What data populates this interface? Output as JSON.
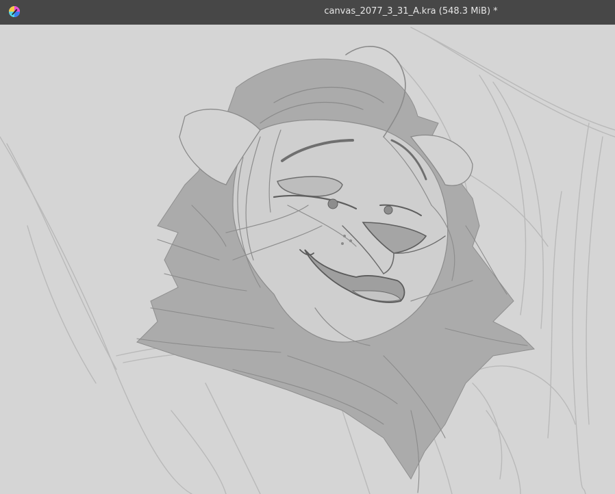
{
  "window": {
    "title": "canvas_2077_3_31_A.kra (548.3 MiB) *",
    "app_icon": "krita-logo-icon"
  },
  "canvas": {
    "background_color": "#d5d5d5",
    "sketch_color": "#9a9a9a",
    "fill_color": "#a9a9a9",
    "content": "sketch-artwork"
  }
}
